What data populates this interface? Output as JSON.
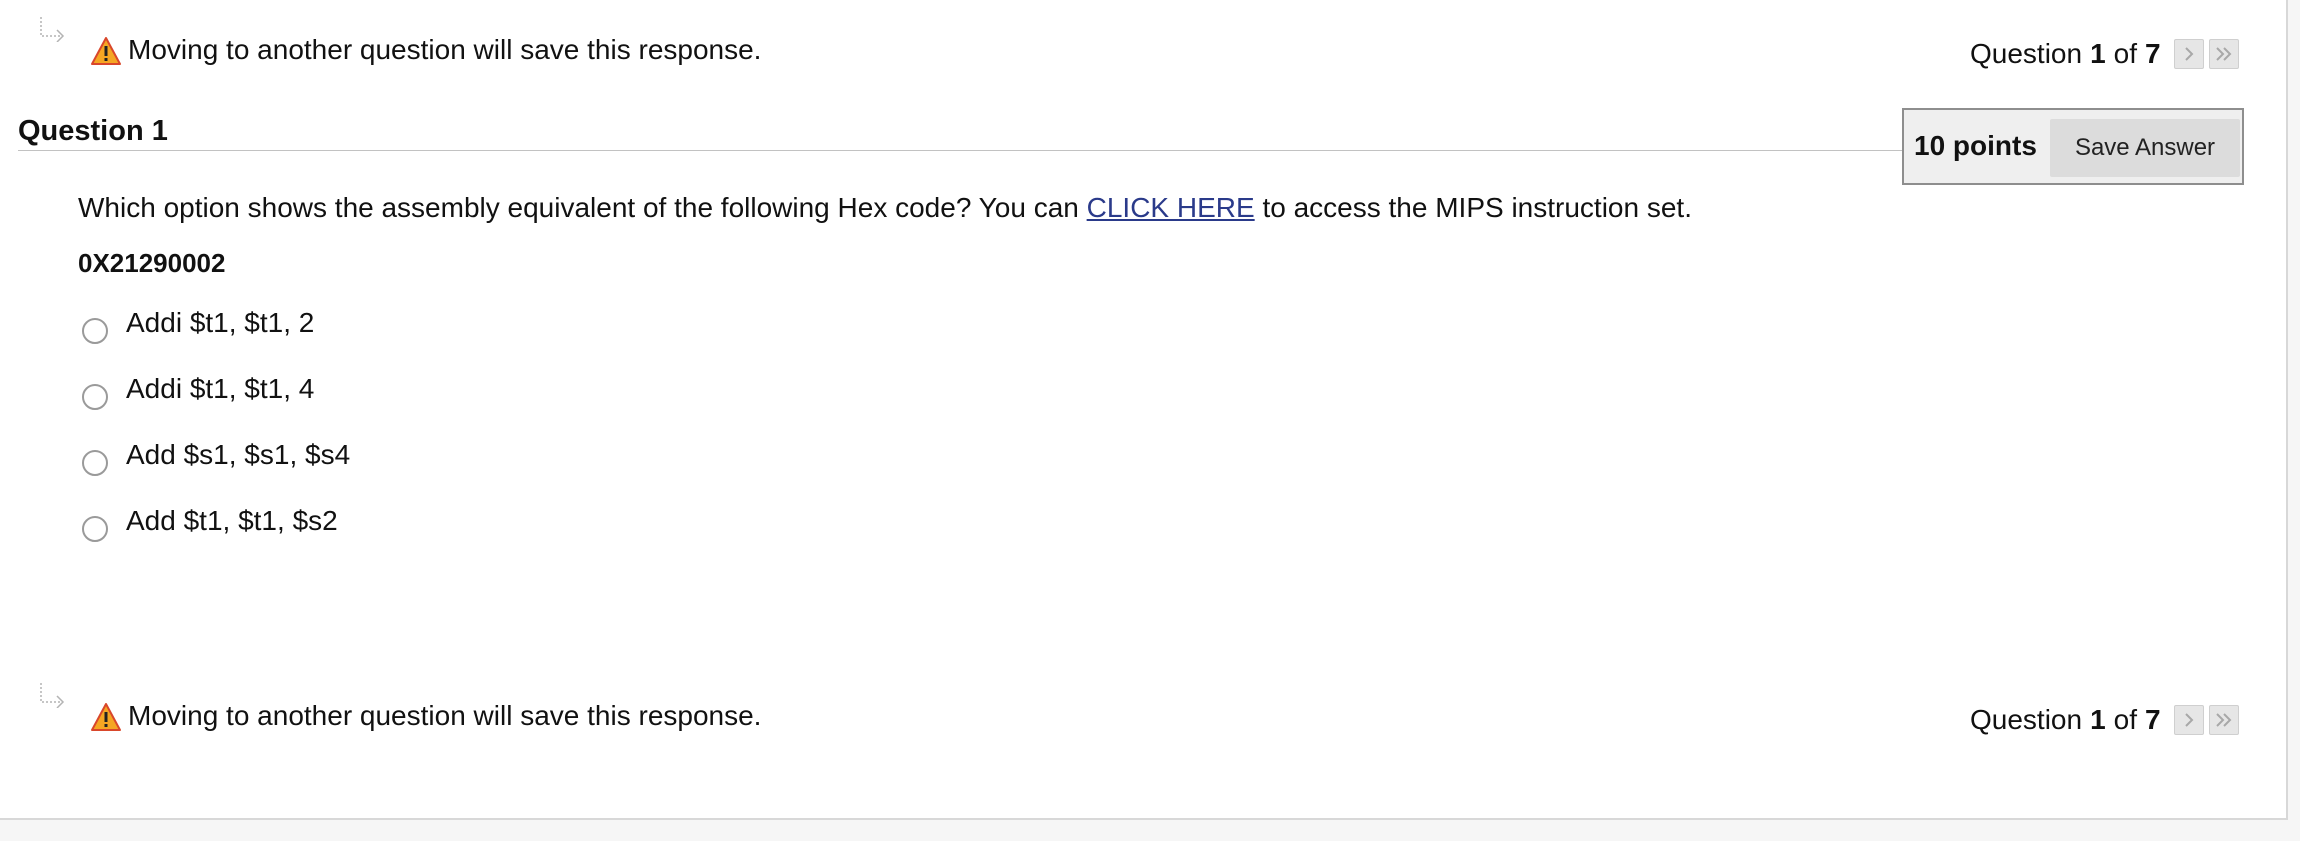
{
  "save_notice": "Moving to another question will save this response.",
  "nav": {
    "prefix": "Question",
    "current": "1",
    "of": "of",
    "total": "7"
  },
  "question": {
    "title": "Question 1",
    "points": "10 points",
    "save_label": "Save Answer",
    "prompt_before": "Which option shows the assembly equivalent of the following Hex code?  You can ",
    "prompt_link": "CLICK HERE",
    "prompt_after": " to access the MIPS instruction set.",
    "hex_code": "0X21290002",
    "options": [
      "Addi $t1, $t1, 2",
      "Addi $t1, $t1, 4",
      "Add $s1, $s1, $s4",
      "Add $t1, $t1, $s2"
    ]
  },
  "colors": {
    "link": "#2a3a8a",
    "warning_fill": "#f5a623",
    "warning_stroke": "#d9472b"
  },
  "icons": {
    "warning": "warning-icon",
    "next": "chevron-right-icon",
    "last": "double-chevron-right-icon",
    "elbow": "elbow-arrow-icon"
  }
}
